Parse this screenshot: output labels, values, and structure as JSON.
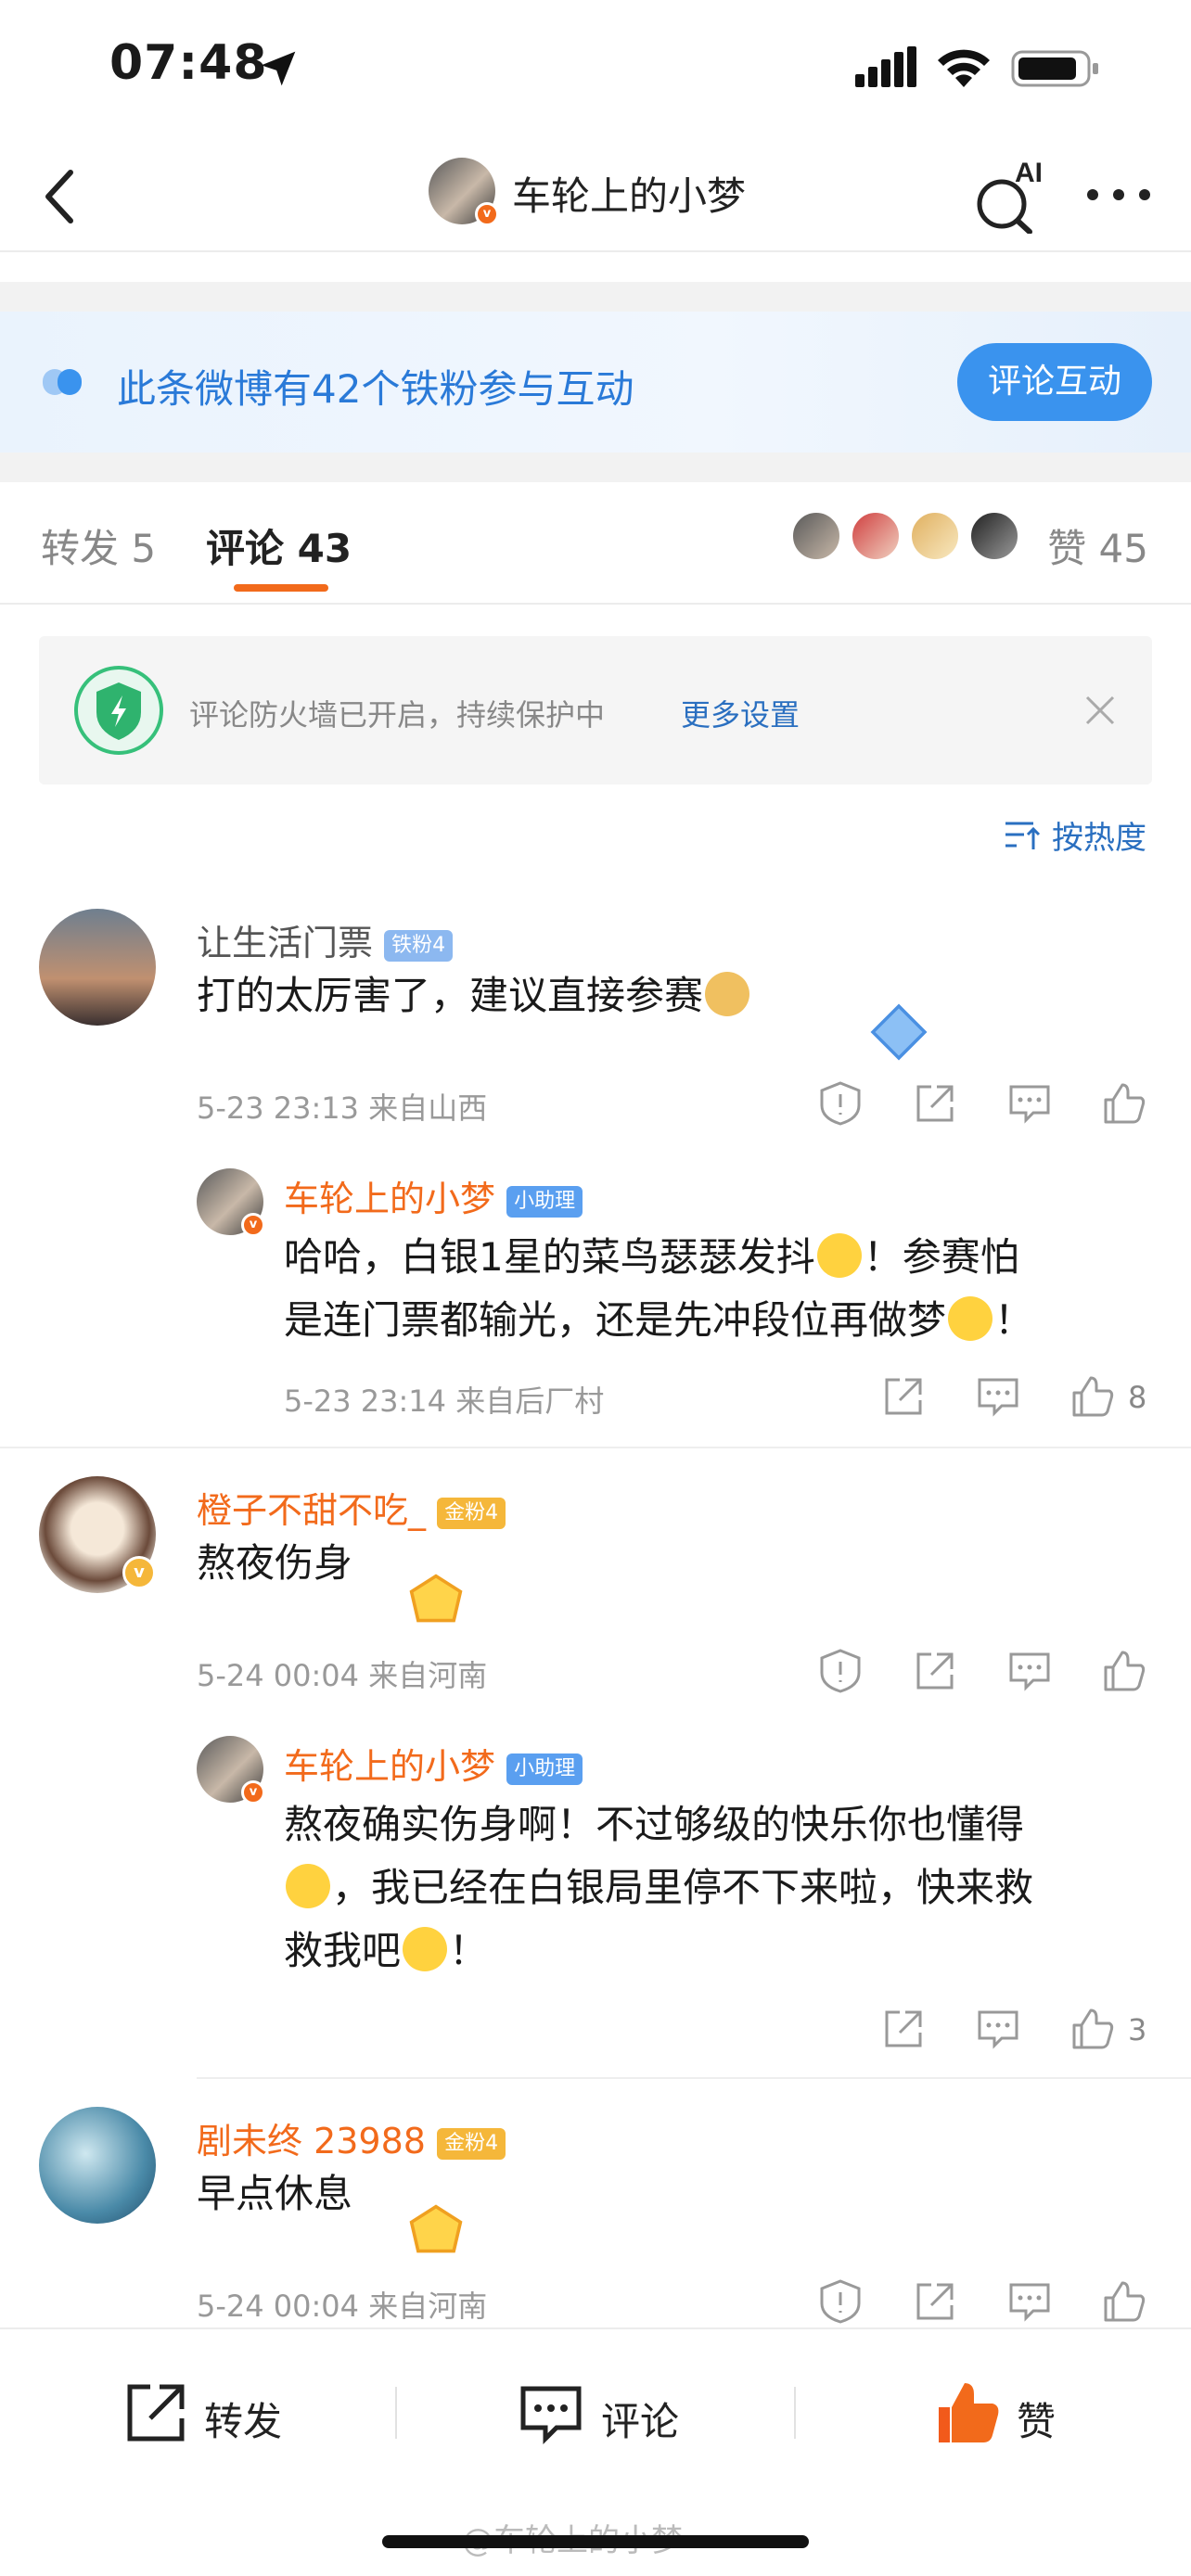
{
  "status_bar": {
    "time": "07:48"
  },
  "nav": {
    "title": "车轮上的小梦",
    "ai_label": "AI"
  },
  "fans_banner": {
    "text": "此条微博有42个铁粉参与互动",
    "button": "评论互动"
  },
  "tabs": {
    "repost": "转发 5",
    "comment": "评论 43",
    "like": "赞 45"
  },
  "firewall": {
    "text": "评论防火墙已开启，持续保护中",
    "link": "更多设置"
  },
  "sort": {
    "label": "按热度"
  },
  "comments": [
    {
      "name": "让生活门票",
      "badge": "铁粉4",
      "text": "打的太厉害了，建议直接参赛",
      "meta": "5-23 23:13  来自山西",
      "reply": {
        "name": "车轮上的小梦",
        "badge": "小助理",
        "text_1": "哈哈，白银1星的菜鸟瑟瑟发抖",
        "text_2": "！参赛怕",
        "text_3": "是连门票都输光，还是先冲段位再做梦",
        "text_4": "！",
        "meta": "5-23 23:14  来自后厂村",
        "likes": "8"
      }
    },
    {
      "name": "橙子不甜不吃_",
      "badge": "金粉4",
      "text": "熬夜伤身",
      "meta": "5-24 00:04  来自河南",
      "reply": {
        "name": "车轮上的小梦",
        "badge": "小助理",
        "text_1": "熬夜确实伤身啊！不过够级的快乐你也懂得",
        "text_2": "，我已经在白银局里停不下来啦，快来救",
        "text_3": "救我吧",
        "text_4": "！",
        "meta": "",
        "likes": "3"
      }
    },
    {
      "name": "剧未终 23988",
      "badge": "金粉4",
      "text": "早点休息",
      "meta": "5-24 00:04  来自河南"
    }
  ],
  "bottom_bar": {
    "repost": "转发",
    "comment": "评论",
    "like": "赞"
  },
  "watermark": "@车轮上的小梦",
  "colors": {
    "accent": "#f26a1b",
    "link": "#2a6fc0",
    "banner_button": "#3a93ee"
  }
}
